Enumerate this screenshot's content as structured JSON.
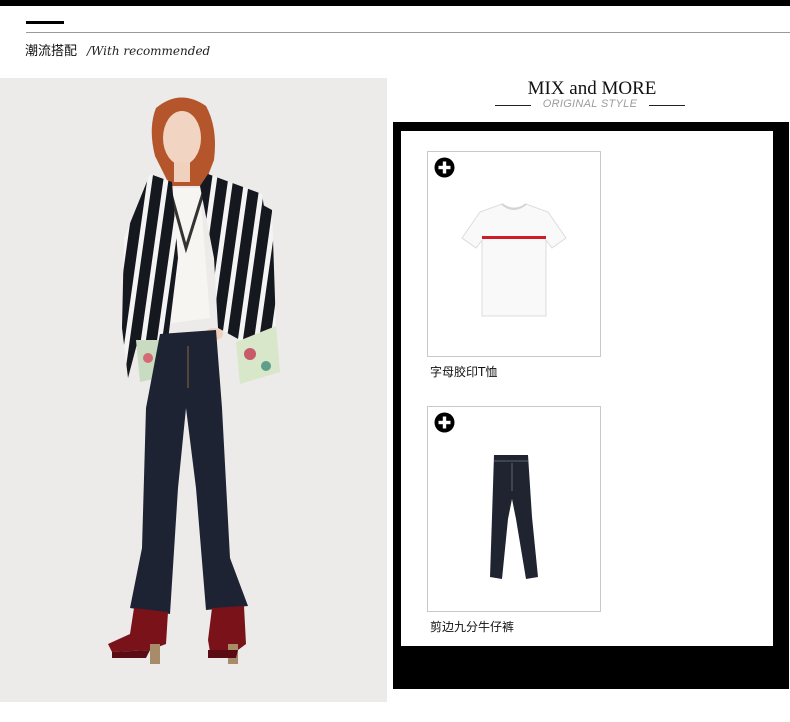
{
  "section": {
    "title_cn": "潮流搭配",
    "title_en": "/With recommended"
  },
  "mix": {
    "title": "MIX and MORE",
    "subtitle": "ORIGINAL STYLE"
  },
  "products": [
    {
      "name": "字母胶印T恤",
      "icon": "plus-icon"
    },
    {
      "name": "剪边九分牛仔裤",
      "icon": "plus-icon"
    }
  ],
  "colors": {
    "frame": "#000000",
    "photo_background": "#ecebea",
    "subtitle_gray": "#9c9c9c",
    "tshirt_stripe": "#d01c24",
    "denim": "#1e2333",
    "boots": "#7a1219"
  }
}
